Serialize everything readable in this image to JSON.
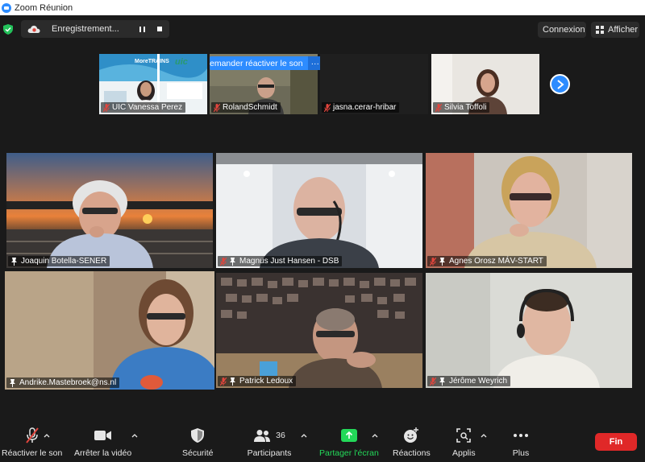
{
  "window": {
    "title": "Zoom Réunion"
  },
  "topbar": {
    "recording_label": "Enregistrement...",
    "connexion_label": "Connexion",
    "afficher_label": "Afficher"
  },
  "strip": {
    "ask_unmute_label": "emander réactiver le son",
    "ask_unmute_more": "···",
    "tiles": [
      {
        "name": "UIC Vanessa Perez",
        "logo_text": "MoreTRAINS",
        "logo2_text": "uic"
      },
      {
        "name": "RolandSchmidt"
      },
      {
        "name": "jasna.cerar-hribar"
      },
      {
        "name": "Silvia Toffoli"
      }
    ]
  },
  "grid": {
    "tiles": [
      {
        "name": "Joaquin Botella-SENER"
      },
      {
        "name": "Magnus Just Hansen - DSB"
      },
      {
        "name": "Agnes Orosz MÁV-START"
      },
      {
        "name": "Andrike.Mastebroek@ns.nl"
      },
      {
        "name": "Patrick Ledoux"
      },
      {
        "name": "Jérôme Weyrich"
      }
    ]
  },
  "toolbar": {
    "unmute_label": "Réactiver le son",
    "stop_video_label": "Arrêter la vidéo",
    "security_label": "Sécurité",
    "participants_label": "Participants",
    "participants_count": "36",
    "share_label": "Partager l'écran",
    "reactions_label": "Réactions",
    "apps_label": "Applis",
    "more_label": "Plus",
    "end_label": "Fin"
  },
  "colors": {
    "zoom_blue": "#2d8cff",
    "share_green": "#23d959",
    "end_red": "#e02828",
    "speaker_highlight": "#c8f08c",
    "muted_red": "#e0453d"
  }
}
